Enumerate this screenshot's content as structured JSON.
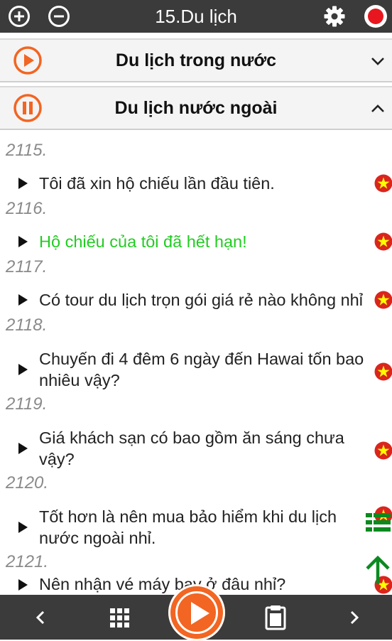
{
  "app_bar": {
    "title": "15.Du lịch",
    "icons": [
      "zoom-in-icon",
      "zoom-out-icon",
      "gear-icon",
      "record-icon"
    ]
  },
  "sections": [
    {
      "title": "Du lịch trong nước",
      "state": "collapsed",
      "icon": "play-circle-icon"
    },
    {
      "title": "Du lịch nước ngoài",
      "state": "expanded",
      "icon": "pause-circle-icon"
    }
  ],
  "items": [
    {
      "number": "2115.",
      "lines": [
        "Tôi đã xin hộ chiếu lần đầu tiên."
      ],
      "active": false
    },
    {
      "number": "2116.",
      "lines": [
        "Hộ chiếu của tôi đã hết hạn!"
      ],
      "active": true
    },
    {
      "number": "2117.",
      "lines": [
        "Có tour du lịch trọn gói giá rẻ nào không nhỉ"
      ],
      "active": false
    },
    {
      "number": "2118.",
      "lines": [
        "Chuyến đi 4 đêm 6 ngày đến Hawai tốn bao",
        "nhiêu vậy?"
      ],
      "active": false
    },
    {
      "number": "2119.",
      "lines": [
        "Giá khách sạn có bao gồm ăn sáng chưa",
        "vậy?"
      ],
      "active": false
    },
    {
      "number": "2120.",
      "lines": [
        "Tốt hơn là nên mua bảo hiểm khi du lịch",
        "nước ngoài nhỉ."
      ],
      "active": false
    },
    {
      "number": "2121.",
      "lines": [
        "Nên nhận vé máy bay ở đâu nhỉ?"
      ],
      "active": false
    }
  ],
  "colors": {
    "bar": "#3b3b3b",
    "accent": "#f26522",
    "active_text": "#22cc22",
    "flag_red": "#da251d",
    "flag_star": "#ffff00",
    "side_green": "#0a8a1f"
  },
  "bottom_bar": {
    "icons": [
      "chevron-left-icon",
      "grid-icon",
      "play-icon",
      "clipboard-icon",
      "chevron-right-icon"
    ]
  }
}
